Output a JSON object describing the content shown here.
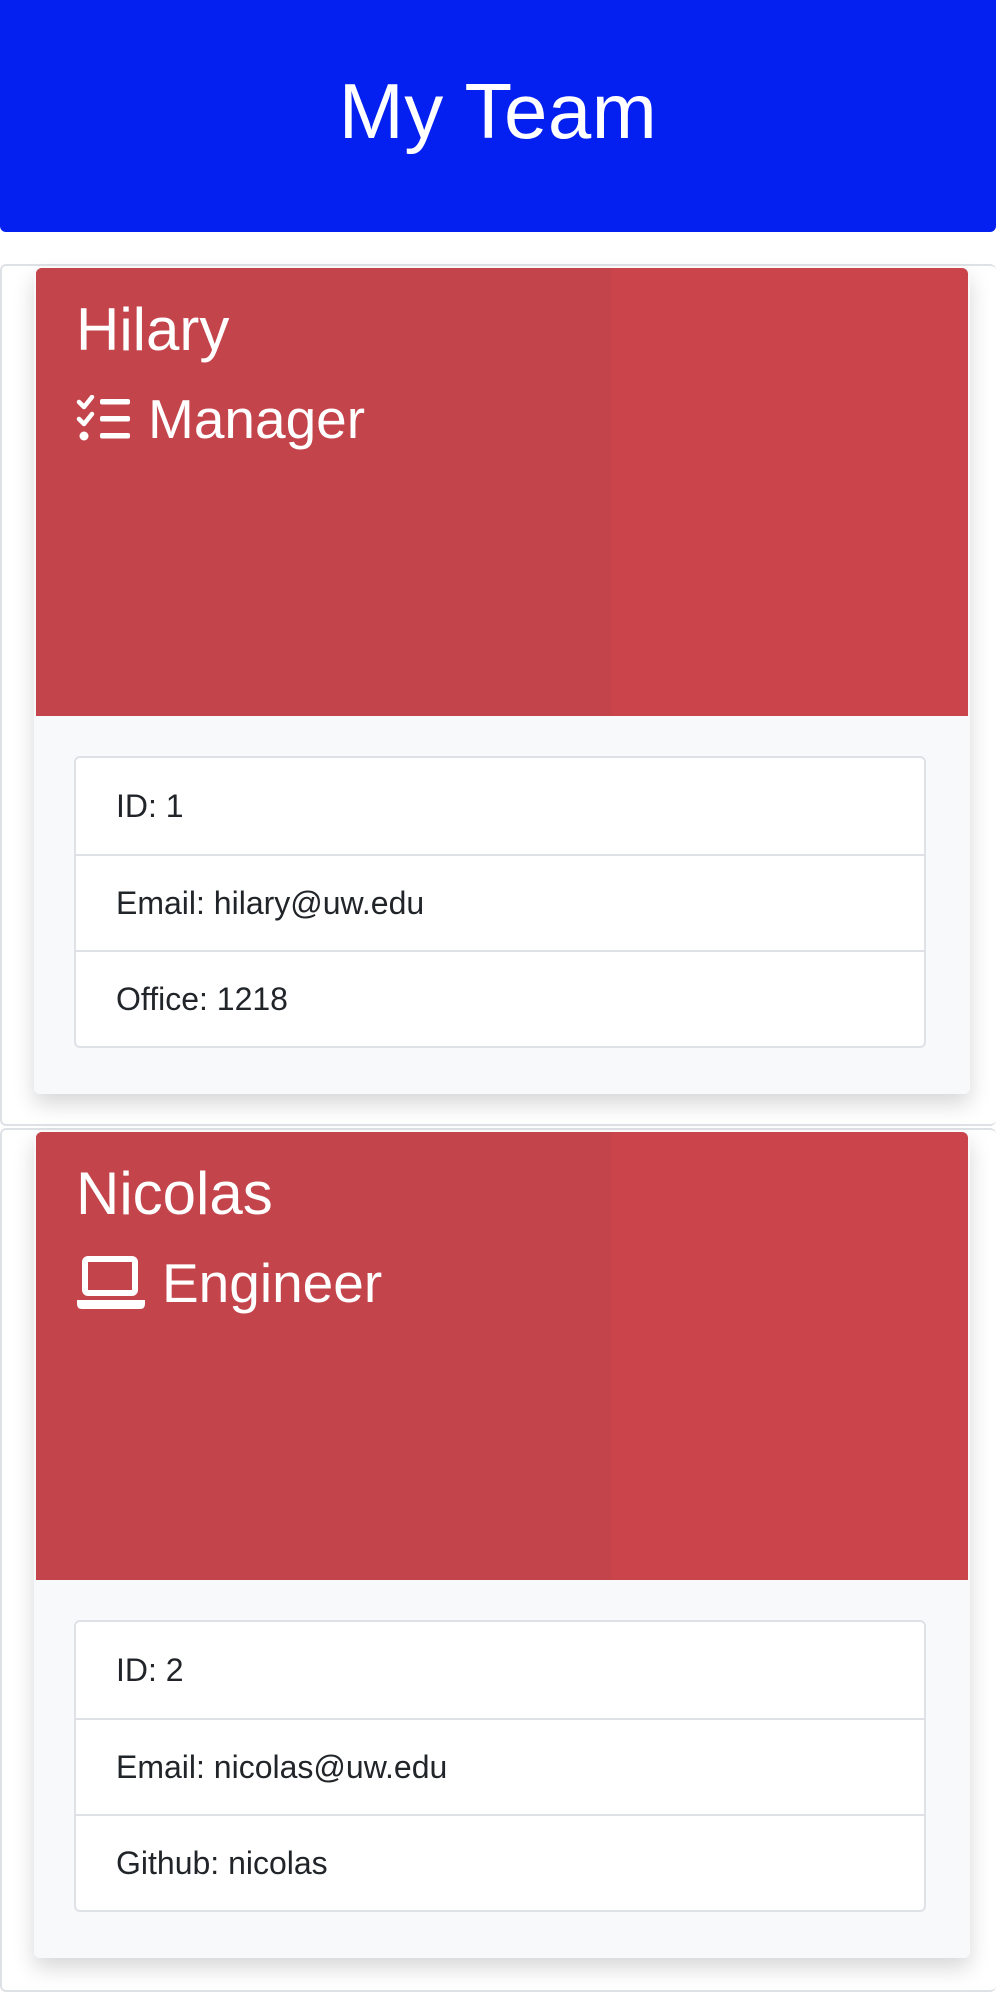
{
  "header": {
    "title": "My Team"
  },
  "employees": [
    {
      "name": "Hilary",
      "role": "Manager",
      "role_icon": "tasks-icon",
      "details": [
        "ID: 1",
        "Email: hilary@uw.edu",
        "Office: 1218"
      ]
    },
    {
      "name": "Nicolas",
      "role": "Engineer",
      "role_icon": "laptop-icon",
      "details": [
        "ID: 2",
        "Email: nicolas@uw.edu",
        "Github: nicolas"
      ]
    }
  ],
  "colors": {
    "header_bg": "#0420f0",
    "card_header_bg": "#cb444c",
    "card_body_bg": "#f8f9fa"
  }
}
